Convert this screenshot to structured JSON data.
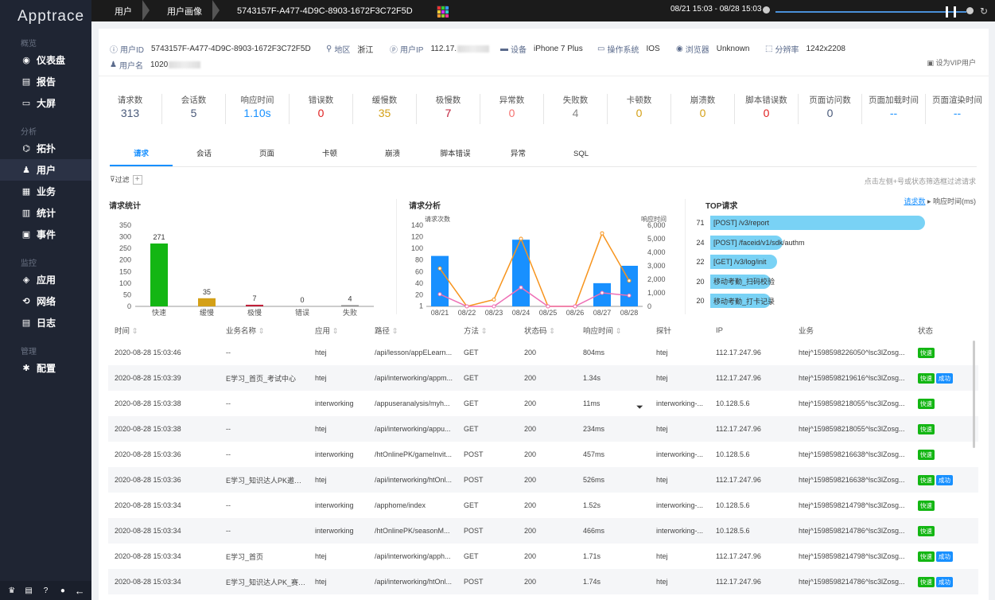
{
  "app": {
    "name": "Apptrace"
  },
  "sidebar": {
    "sections": [
      {
        "title": "概览",
        "items": [
          {
            "label": "仪表盘",
            "icon": "dashboard-icon"
          },
          {
            "label": "报告",
            "icon": "report-icon"
          },
          {
            "label": "大屏",
            "icon": "monitor-icon"
          }
        ]
      },
      {
        "title": "分析",
        "items": [
          {
            "label": "拓扑",
            "icon": "topology-icon"
          },
          {
            "label": "用户",
            "icon": "user-icon",
            "active": true
          },
          {
            "label": "业务",
            "icon": "briefcase-icon"
          },
          {
            "label": "统计",
            "icon": "stats-icon"
          },
          {
            "label": "事件",
            "icon": "event-icon"
          }
        ]
      },
      {
        "title": "监控",
        "items": [
          {
            "label": "应用",
            "icon": "app-icon"
          },
          {
            "label": "网络",
            "icon": "network-icon"
          },
          {
            "label": "日志",
            "icon": "log-icon"
          }
        ]
      },
      {
        "title": "管理",
        "items": [
          {
            "label": "配置",
            "icon": "gear-icon"
          }
        ]
      }
    ]
  },
  "breadcrumb": [
    "用户",
    "用户画像",
    "5743157F-A477-4D9C-8903-1672F3C72F5D"
  ],
  "time_range": "08/21 15:03 - 08/28 15:03",
  "info": {
    "user_id_label": "用户ID",
    "user_id": "5743157F-A477-4D9C-8903-1672F3C72F5D",
    "region_label": "地区",
    "region": "浙江",
    "ip_label": "用户IP",
    "ip": "112.17.",
    "device_label": "设备",
    "device": "iPhone 7 Plus",
    "os_label": "操作系统",
    "os": "IOS",
    "browser_label": "浏览器",
    "browser": "Unknown",
    "resolution_label": "分辨率",
    "resolution": "1242x2208",
    "username_label": "用户名",
    "username": "1020",
    "vip_label": "设为VIP用户"
  },
  "stats": [
    {
      "label": "请求数",
      "value": "313",
      "color": "#4a5a7a"
    },
    {
      "label": "会话数",
      "value": "5",
      "color": "#4a5a7a"
    },
    {
      "label": "响应时间",
      "value": "1.10s",
      "color": "#1890ff"
    },
    {
      "label": "错误数",
      "value": "0",
      "color": "#e02020"
    },
    {
      "label": "缓慢数",
      "value": "35",
      "color": "#d4a017"
    },
    {
      "label": "极慢数",
      "value": "7",
      "color": "#c0203a"
    },
    {
      "label": "异常数",
      "value": "0",
      "color": "#f5706e"
    },
    {
      "label": "失败数",
      "value": "4",
      "color": "#888"
    },
    {
      "label": "卡顿数",
      "value": "0",
      "color": "#d4a017"
    },
    {
      "label": "崩溃数",
      "value": "0",
      "color": "#d4a017"
    },
    {
      "label": "脚本错误数",
      "value": "0",
      "color": "#e02020"
    },
    {
      "label": "页面访问数",
      "value": "0",
      "color": "#4a5a7a"
    },
    {
      "label": "页面加载时间",
      "value": "--",
      "color": "#1890ff"
    },
    {
      "label": "页面渲染时间",
      "value": "--",
      "color": "#1890ff"
    }
  ],
  "tabs": [
    "请求",
    "会话",
    "页面",
    "卡顿",
    "崩溃",
    "脚本错误",
    "异常",
    "SQL"
  ],
  "filter": {
    "label": "过滤",
    "hint": "点击左侧+号或状态筛选框过滤请求"
  },
  "panels": {
    "req_stats": "请求统计",
    "req_analysis": "请求分析",
    "top_req": "TOP请求"
  },
  "top_sort": {
    "count": "请求数",
    "time": "响应时间(ms)"
  },
  "chart_data": [
    {
      "type": "bar",
      "title": "请求统计",
      "categories": [
        "快速",
        "缓慢",
        "极慢",
        "错误",
        "失败"
      ],
      "values": [
        271,
        35,
        7,
        0,
        4
      ],
      "colors": [
        "#13b613",
        "#d4a017",
        "#c0203a",
        "#888",
        "#888"
      ],
      "ylim": [
        0,
        350
      ],
      "yticks": [
        0,
        50,
        100,
        150,
        200,
        250,
        300,
        350
      ]
    },
    {
      "type": "bar+line",
      "title": "请求分析",
      "ylabel": "请求次数",
      "y2label": "响应时间",
      "categories": [
        "08/21",
        "08/22",
        "08/23",
        "08/24",
        "08/25",
        "08/26",
        "08/27",
        "08/28"
      ],
      "yticks": [
        1,
        20,
        40,
        60,
        80,
        100,
        120,
        140
      ],
      "y2ticks": [
        0,
        1000,
        2000,
        3000,
        4000,
        5000,
        6000
      ],
      "ylim": [
        0,
        140
      ],
      "y2lim": [
        0,
        6000
      ],
      "series": [
        {
          "values": [
            87,
            0,
            0,
            115,
            0,
            0,
            40,
            70
          ],
          "color": "#1890ff"
        },
        {
          "values": [
            2800,
            0,
            500,
            5000,
            0,
            0,
            5400,
            1900
          ],
          "color": "#f7941d"
        },
        {
          "values": [
            900,
            0,
            0,
            1400,
            0,
            0,
            1000,
            800
          ],
          "color": "#ee6fb5"
        }
      ]
    },
    {
      "type": "bar",
      "title": "TOP请求",
      "categories": [
        "[POST] /v3/report",
        "[POST] /faceid/v1/sdk/authm",
        "[GET] /v3/log/init",
        "移动考勤_扫码校验",
        "移动考勤_打卡记录"
      ],
      "values": [
        71,
        24,
        22,
        20,
        20
      ]
    }
  ],
  "table": {
    "headers": [
      "时间",
      "业务名称",
      "应用",
      "路径",
      "方法",
      "状态码",
      "响应时间",
      "探针",
      "IP",
      "业务",
      "状态"
    ],
    "rows": [
      [
        "2020-08-28 15:03:46",
        "--",
        "htej",
        "/api/lesson/appELearn...",
        "GET",
        "200",
        "804ms",
        "htej",
        "112.17.247.96",
        "htej^1598598226050^lsc3lZosg...",
        [
          "快速"
        ]
      ],
      [
        "2020-08-28 15:03:39",
        "E学习_首页_考试中心",
        "htej",
        "/api/interworking/appm...",
        "GET",
        "200",
        "1.34s",
        "htej",
        "112.17.247.96",
        "htej^1598598219616^lsc3lZosg...",
        [
          "快速",
          "成功"
        ]
      ],
      [
        "2020-08-28 15:03:38",
        "--",
        "interworking",
        "/appuseranalysis/myh...",
        "GET",
        "200",
        "11ms",
        "interworking-...",
        "10.128.5.6",
        "htej^1598598218055^lsc3lZosg...",
        [
          "快速"
        ]
      ],
      [
        "2020-08-28 15:03:38",
        "--",
        "htej",
        "/api/interworking/appu...",
        "GET",
        "200",
        "234ms",
        "htej",
        "112.17.247.96",
        "htej^1598598218055^lsc3lZosg...",
        [
          "快速"
        ]
      ],
      [
        "2020-08-28 15:03:36",
        "--",
        "interworking",
        "/htOnlinePK/gameInvit...",
        "POST",
        "200",
        "457ms",
        "interworking-...",
        "10.128.5.6",
        "htej^1598598216638^lsc3lZosg...",
        [
          "快速"
        ]
      ],
      [
        "2020-08-28 15:03:36",
        "E学习_知识达人PK邀请好友",
        "htej",
        "/api/interworking/htOnl...",
        "POST",
        "200",
        "526ms",
        "htej",
        "112.17.247.96",
        "htej^1598598216638^lsc3lZosg...",
        [
          "快速",
          "成功"
        ]
      ],
      [
        "2020-08-28 15:03:34",
        "--",
        "interworking",
        "/apphome/index",
        "GET",
        "200",
        "1.52s",
        "interworking-...",
        "10.128.5.6",
        "htej^1598598214798^lsc3lZosg...",
        [
          "快速"
        ]
      ],
      [
        "2020-08-28 15:03:34",
        "--",
        "interworking",
        "/htOnlinePK/seasonM...",
        "POST",
        "200",
        "466ms",
        "interworking-...",
        "10.128.5.6",
        "htej^1598598214786^lsc3lZosg...",
        [
          "快速"
        ]
      ],
      [
        "2020-08-28 15:03:34",
        "E学习_首页",
        "htej",
        "/api/interworking/apph...",
        "GET",
        "200",
        "1.71s",
        "htej",
        "112.17.247.96",
        "htej^1598598214798^lsc3lZosg...",
        [
          "快速",
          "成功"
        ]
      ],
      [
        "2020-08-28 15:03:34",
        "E学习_知识达人PK_赛季首",
        "htej",
        "/api/interworking/htOnl...",
        "POST",
        "200",
        "1.74s",
        "htej",
        "112.17.247.96",
        "htej^1598598214786^lsc3lZosg...",
        [
          "快速",
          "成功"
        ]
      ]
    ]
  }
}
